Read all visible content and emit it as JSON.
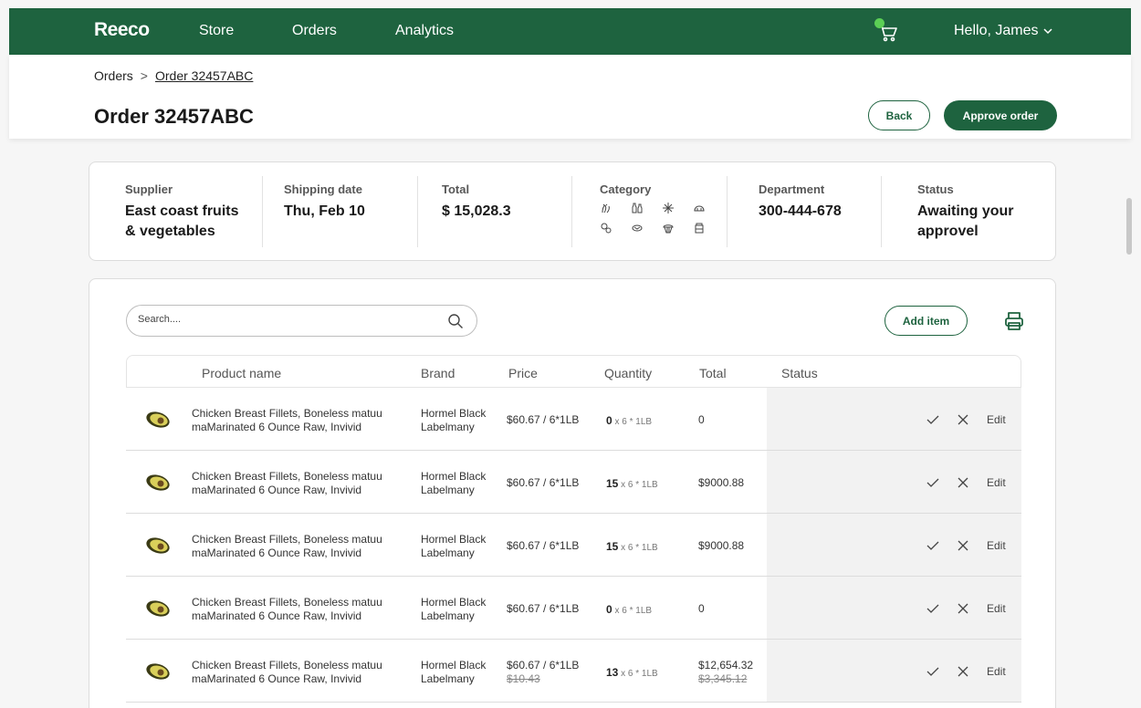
{
  "nav": {
    "logo": "Reeco",
    "links": [
      "Store",
      "Orders",
      "Analytics"
    ],
    "greeting": "Hello, James"
  },
  "breadcrumb": {
    "root": "Orders",
    "separator": ">",
    "current": "Order 32457ABC"
  },
  "page": {
    "title": "Order 32457ABC",
    "back_label": "Back",
    "approve_label": "Approve order"
  },
  "summary": {
    "supplier": {
      "label": "Supplier",
      "value_line1": "East coast fruits",
      "value_line2": "& vegetables"
    },
    "shipping": {
      "label": "Shipping date",
      "value": "Thu, Feb 10"
    },
    "total": {
      "label": "Total",
      "value": "$ 15,028.3"
    },
    "category": {
      "label": "Category",
      "icons": [
        "vegetables-icon",
        "bottles-icon",
        "snowflake-icon",
        "bread-icon",
        "pills-icon",
        "fish-icon",
        "cupcake-icon",
        "jar-icon"
      ]
    },
    "department": {
      "label": "Department",
      "value": "300-444-678"
    },
    "status": {
      "label": "Status",
      "value_line1": "Awaiting your",
      "value_line2": "approvel"
    }
  },
  "search": {
    "placeholder": "Search...."
  },
  "add_item_label": "Add item",
  "table": {
    "headers": {
      "product": "Product name",
      "brand": "Brand",
      "price": "Price",
      "quantity": "Quantity",
      "total": "Total",
      "status": "Status"
    },
    "rows": [
      {
        "name_line1": "Chicken Breast Fillets, Boneless matuu",
        "name_line2": "maMarinated 6 Ounce Raw, Invivid",
        "brand_line1": "Hormel Black",
        "brand_line2": "Labelmany",
        "price": "$60.67 / 6*1LB",
        "old_price": "",
        "qty": "0",
        "qty_unit": " x 6 * 1LB",
        "total": "0",
        "old_total": "",
        "edit": "Edit"
      },
      {
        "name_line1": "Chicken Breast Fillets, Boneless matuu",
        "name_line2": "maMarinated 6 Ounce Raw, Invivid",
        "brand_line1": "Hormel Black",
        "brand_line2": "Labelmany",
        "price": "$60.67 / 6*1LB",
        "old_price": "",
        "qty": "15",
        "qty_unit": " x 6 * 1LB",
        "total": "$9000.88",
        "old_total": "",
        "edit": "Edit"
      },
      {
        "name_line1": "Chicken Breast Fillets, Boneless matuu",
        "name_line2": "maMarinated 6 Ounce Raw, Invivid",
        "brand_line1": "Hormel Black",
        "brand_line2": "Labelmany",
        "price": "$60.67 / 6*1LB",
        "old_price": "",
        "qty": "15",
        "qty_unit": " x 6 * 1LB",
        "total": "$9000.88",
        "old_total": "",
        "edit": "Edit"
      },
      {
        "name_line1": "Chicken Breast Fillets, Boneless matuu",
        "name_line2": "maMarinated 6 Ounce Raw, Invivid",
        "brand_line1": "Hormel Black",
        "brand_line2": "Labelmany",
        "price": "$60.67 / 6*1LB",
        "old_price": "",
        "qty": "0",
        "qty_unit": " x 6 * 1LB",
        "total": "0",
        "old_total": "",
        "edit": "Edit"
      },
      {
        "name_line1": "Chicken Breast Fillets, Boneless matuu",
        "name_line2": "maMarinated 6 Ounce Raw, Invivid",
        "brand_line1": "Hormel Black",
        "brand_line2": "Labelmany",
        "price": "$60.67 / 6*1LB",
        "old_price": "$10.43",
        "qty": "13",
        "qty_unit": " x 6 * 1LB",
        "total": "$12,654.32",
        "old_total": "$3,345.12",
        "edit": "Edit"
      }
    ]
  },
  "colors": {
    "brand": "#1e633f",
    "cart_badge": "#5bcf55",
    "status_cell": "#f2f2f2"
  }
}
